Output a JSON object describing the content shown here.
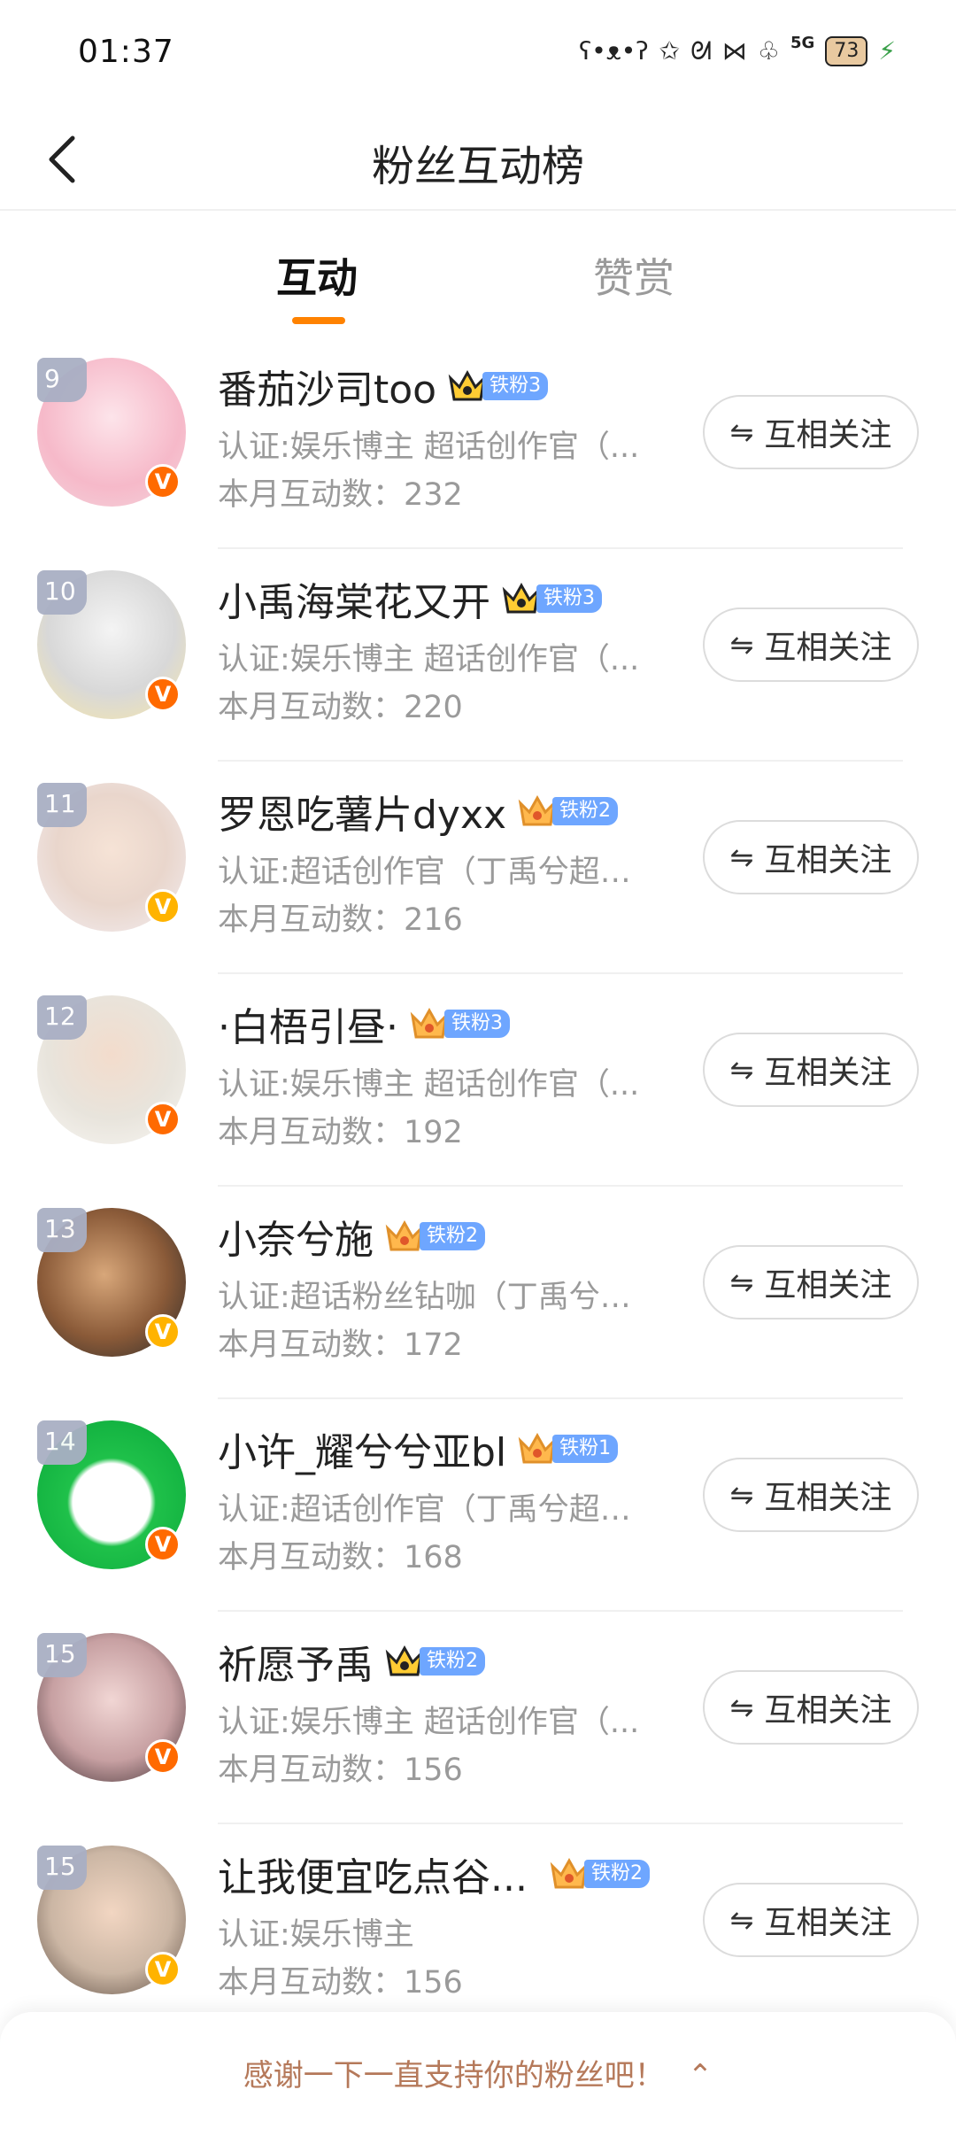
{
  "status_bar": {
    "time": "01:37",
    "icons": [
      "bear-icon",
      "star-face-icon",
      "bunny-icon",
      "bow-icon",
      "strawberry-icon",
      "signal-5g-icon",
      "battery-icon",
      "charging-icon"
    ],
    "network": "5G",
    "battery": "73"
  },
  "header": {
    "title": "粉丝互动榜"
  },
  "tabs": [
    {
      "label": "互动",
      "active": true
    },
    {
      "label": "赞赏",
      "active": false
    }
  ],
  "accent_color": "#ff8200",
  "fans": [
    {
      "rank": "9",
      "name": "番茄沙司too",
      "badge": "铁粉3",
      "cert": "认证:娱乐博主 超话创作官（...",
      "count": "本月互动数：232",
      "follow": "互相关注",
      "verify": "orange"
    },
    {
      "rank": "10",
      "name": "小禹海棠花又开",
      "badge": "铁粉3",
      "cert": "认证:娱乐博主 超话创作官（...",
      "count": "本月互动数：220",
      "follow": "互相关注",
      "verify": "orange"
    },
    {
      "rank": "11",
      "name": "罗恩吃薯片dyxx",
      "badge": "铁粉2",
      "cert": "认证:超话创作官（丁禹兮超话）",
      "count": "本月互动数：216",
      "follow": "互相关注",
      "verify": "yellow"
    },
    {
      "rank": "12",
      "name": "·白梧引昼·",
      "badge": "铁粉3",
      "cert": "认证:娱乐博主 超话创作官（...",
      "count": "本月互动数：192",
      "follow": "互相关注",
      "verify": "orange"
    },
    {
      "rank": "13",
      "name": "小奈兮施",
      "badge": "铁粉2",
      "cert": "认证:超话粉丝钻咖（丁禹兮超...",
      "count": "本月互动数：172",
      "follow": "互相关注",
      "verify": "yellow"
    },
    {
      "rank": "14",
      "name": "小许_耀兮兮亚bl",
      "badge": "铁粉1",
      "cert": "认证:超话创作官（丁禹兮超话）",
      "count": "本月互动数：168",
      "follow": "互相关注",
      "verify": "orange"
    },
    {
      "rank": "15",
      "name": "祈愿予禹",
      "badge": "铁粉2",
      "cert": "认证:娱乐博主 超话创作官（...",
      "count": "本月互动数：156",
      "follow": "互相关注",
      "verify": "orange"
    },
    {
      "rank": "15",
      "name": "让我便宜吃点谷...",
      "badge": "铁粉2",
      "cert": "认证:娱乐博主",
      "count": "本月互动数：156",
      "follow": "互相关注",
      "verify": "yellow"
    }
  ],
  "verify_mark": "V",
  "follow_icon_glyph": "⇋",
  "bottom": {
    "text": "感谢一下一直支持你的粉丝吧！",
    "chevron": "⌃"
  }
}
